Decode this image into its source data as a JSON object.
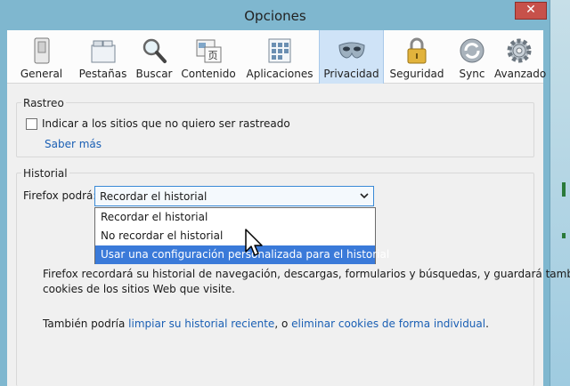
{
  "window": {
    "title": "Opciones",
    "close_glyph": "✕"
  },
  "toolbar": {
    "selected": "privacidad",
    "items": [
      {
        "id": "general",
        "label": "General",
        "icon": "switch-icon"
      },
      {
        "id": "pestanas",
        "label": "Pestañas",
        "icon": "tabs-icon"
      },
      {
        "id": "buscar",
        "label": "Buscar",
        "icon": "magnifier-icon"
      },
      {
        "id": "contenido",
        "label": "Contenido",
        "icon": "content-icon"
      },
      {
        "id": "aplicaciones",
        "label": "Aplicaciones",
        "icon": "applications-icon"
      },
      {
        "id": "privacidad",
        "label": "Privacidad",
        "icon": "mask-icon"
      },
      {
        "id": "seguridad",
        "label": "Seguridad",
        "icon": "padlock-icon"
      },
      {
        "id": "sync",
        "label": "Sync",
        "icon": "sync-icon"
      },
      {
        "id": "avanzado",
        "label": "Avanzado",
        "icon": "gear-icon"
      }
    ]
  },
  "rastreo": {
    "title": "Rastreo",
    "checkbox_label": "Indicar a los sitios que no quiero ser rastreado",
    "checked": false,
    "learn_more": "Saber más"
  },
  "historial": {
    "title": "Historial",
    "firefox_label": "Firefox podrá:",
    "select_value": "Recordar el historial",
    "options": [
      "Recordar el historial",
      "No recordar el historial",
      "Usar una configuración personalizada para el historial"
    ],
    "highlighted_index": 2,
    "description_line1": "Firefox recordará su historial de navegación, descargas, formularios y búsquedas, y guardará también",
    "description_line2": "cookies de los sitios Web que visite.",
    "also_prefix": "También podría ",
    "clear_recent_link": "limpiar su historial reciente",
    "also_middle": ", o ",
    "remove_cookies_link": "eliminar cookies de forma individual",
    "also_suffix": "."
  },
  "colors": {
    "window_frame": "#7fb7cf",
    "selected_tab": "#cfe3f7",
    "highlight": "#3a7ad9",
    "link": "#1a5fb4",
    "close": "#c7514a"
  }
}
